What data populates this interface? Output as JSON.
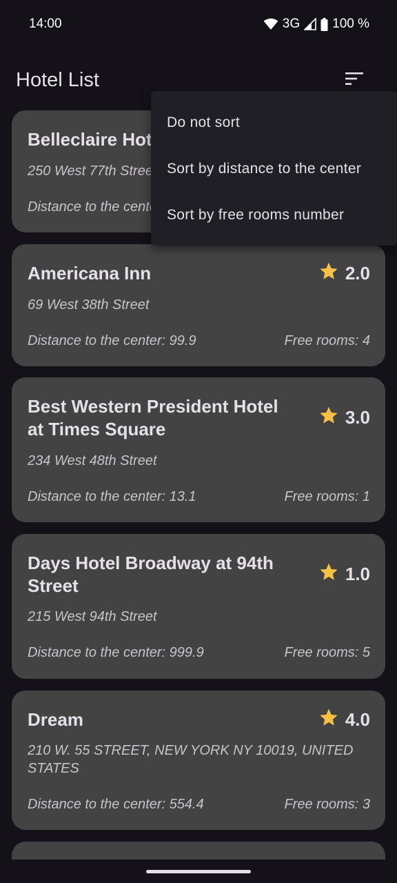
{
  "status_bar": {
    "time": "14:00",
    "network": "3G",
    "battery": "100 %",
    "icons": [
      "wifi-icon",
      "signal-icon",
      "battery-icon"
    ]
  },
  "app_bar": {
    "title": "Hotel List",
    "sort_icon": "sort-icon"
  },
  "sort_menu": {
    "items": [
      {
        "label": "Do not sort"
      },
      {
        "label": "Sort by distance to the center"
      },
      {
        "label": "Sort by free rooms number"
      }
    ]
  },
  "hotels": [
    {
      "name": "Belleclaire Hotel",
      "address": "250 West 77th Street",
      "rating": "",
      "distance": "Distance to the center: ",
      "rooms": ""
    },
    {
      "name": "Americana Inn",
      "address": "69 West 38th Street",
      "rating": "2.0",
      "distance": "Distance to the center: 99.9",
      "rooms": "Free rooms: 4"
    },
    {
      "name": "Best Western President Hotel at Times Square",
      "address": "234 West 48th Street",
      "rating": "3.0",
      "distance": "Distance to the center: 13.1",
      "rooms": "Free rooms: 1"
    },
    {
      "name": "Days Hotel Broadway at 94th Street",
      "address": "215 West 94th Street",
      "rating": "1.0",
      "distance": "Distance to the center: 999.9",
      "rooms": "Free rooms: 5"
    },
    {
      "name": "Dream",
      "address": "210 W. 55 STREET, NEW YORK NY 10019, UNITED STATES",
      "rating": "4.0",
      "distance": "Distance to the center: 554.4",
      "rooms": "Free rooms: 3"
    }
  ],
  "colors": {
    "background": "#141218",
    "card": "#434343",
    "star": "#f6c144",
    "menu": "#211f26"
  }
}
